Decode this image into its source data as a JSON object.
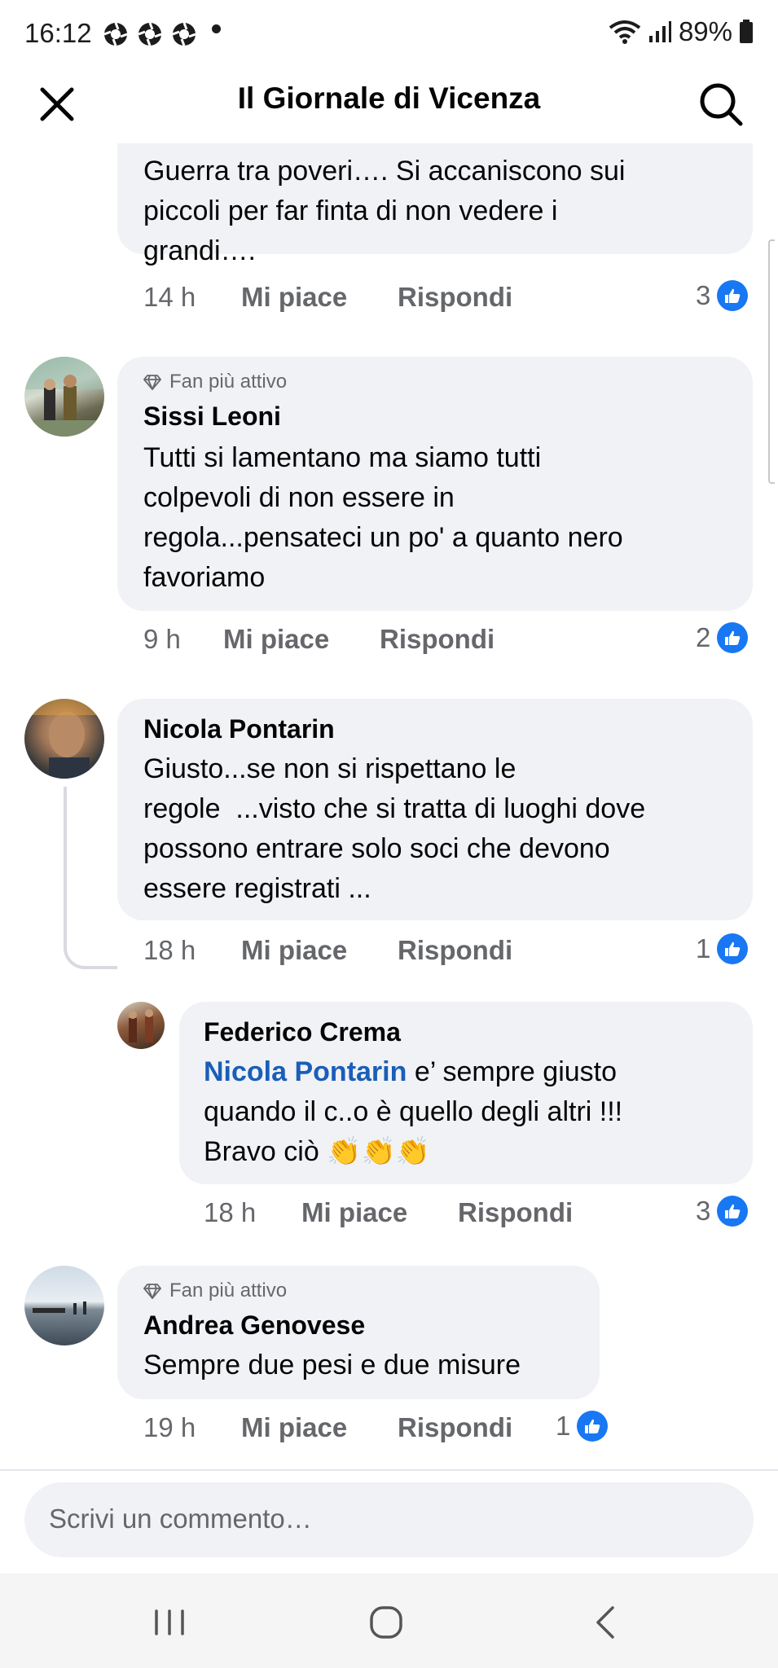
{
  "status_bar": {
    "time": "16:12",
    "battery": "89%"
  },
  "header": {
    "title": "Il Giornale di Vicenza"
  },
  "comments": [
    {
      "text": [
        "Guerra tra poveri…. Si accaniscono sui",
        "piccoli per far finta di non vedere i",
        "grandi…."
      ],
      "time": "14 h",
      "like_label": "Mi piace",
      "reply_label": "Rispondi",
      "reactions": "3"
    },
    {
      "badge": "Fan più attivo",
      "name": "Sissi Leoni",
      "text": [
        "Tutti si lamentano ma siamo tutti",
        "colpevoli di non essere in",
        "regola...pensateci un po' a quanto nero",
        "favoriamo"
      ],
      "time": "9 h",
      "like_label": "Mi piace",
      "reply_label": "Rispondi",
      "reactions": "2"
    },
    {
      "name": "Nicola Pontarin",
      "text": [
        "Giusto...se non si rispettano le",
        "regole  ...visto che si tratta di luoghi dove",
        "possono entrare solo soci che devono",
        "essere registrati ..."
      ],
      "time": "18 h",
      "like_label": "Mi piace",
      "reply_label": "Rispondi",
      "reactions": "1"
    },
    {
      "name": "Federico Crema",
      "mention": "Nicola Pontarin",
      "text": [
        " e’ sempre giusto",
        "quando il c..o è quello degli altri !!!",
        "Bravo ciò 👏👏👏"
      ],
      "time": "18 h",
      "like_label": "Mi piace",
      "reply_label": "Rispondi",
      "reactions": "3"
    },
    {
      "badge": "Fan più attivo",
      "name": "Andrea Genovese",
      "text": [
        "Sempre due pesi e due misure"
      ],
      "time": "19 h",
      "like_label": "Mi piace",
      "reply_label": "Rispondi",
      "reactions": "1"
    }
  ],
  "composer": {
    "placeholder": "Scrivi un commento…"
  },
  "icons": {
    "close": "close-icon",
    "search": "search-icon",
    "like": "like-icon",
    "badge": "diamond-icon"
  },
  "colors": {
    "accent": "#1877f2",
    "mention": "#1a5eb8",
    "bubble": "#f0f2f5",
    "meta": "#65676b"
  }
}
